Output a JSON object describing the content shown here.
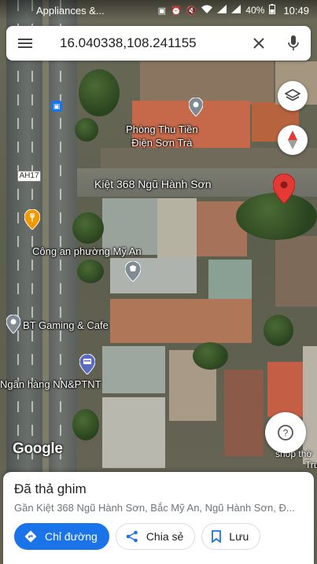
{
  "status_bar": {
    "notification": "Appliances &...",
    "battery": "40%",
    "time": "10:49"
  },
  "search": {
    "query": "16.040338,108.241155"
  },
  "map": {
    "labels": {
      "place1_line1": "Phòng Thu Tiền",
      "place1_line2": "Điện Sơn Trà",
      "street": "Kiệt 368 Ngũ Hành Sơn",
      "police": "Công an phường Mỹ An",
      "gaming": "BT Gaming & Cafe",
      "bank": "Ngân hàng NN&PTNT",
      "shield": "AH17",
      "shop_line1": "shop thờ",
      "shop_line2": "Tru"
    },
    "logo": "Google",
    "icons": {
      "layers": "layers-icon",
      "compass": "compass-icon",
      "explore": "explore-icon",
      "dropped_pin": "red-pin-icon"
    }
  },
  "place_sheet": {
    "title": "Đã thả ghim",
    "subtitle": "Gần Kiệt 368 Ngũ Hành Sơn, Bắc Mỹ An, Ngũ Hành Sơn, Đ...",
    "actions": {
      "directions": "Chỉ đường",
      "share": "Chia sẻ",
      "save": "Lưu"
    }
  },
  "colors": {
    "accent": "#1a73e8",
    "pin": "#e53935"
  }
}
